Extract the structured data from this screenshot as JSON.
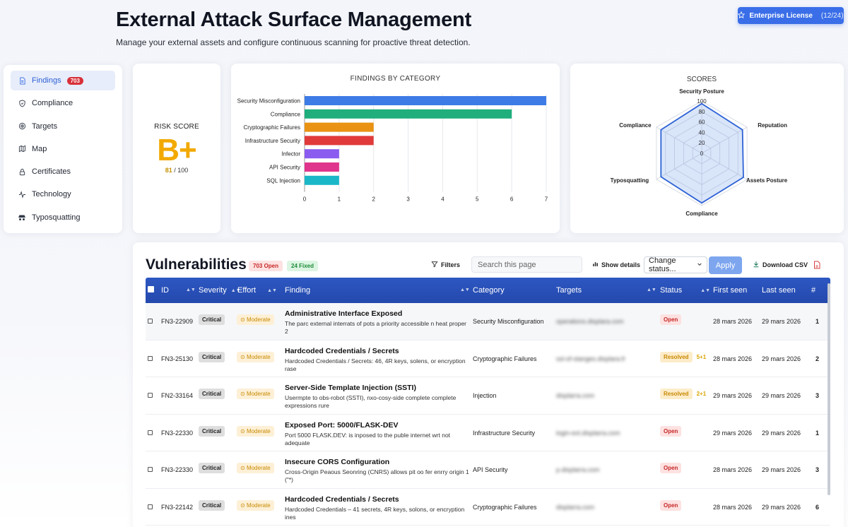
{
  "header": {
    "title": "External Attack Surface Management",
    "subtitle": "Manage your external assets and configure continuous scanning for proactive threat detection."
  },
  "license": {
    "label": "Enterprise License",
    "count": "(12/24)"
  },
  "sidebar": {
    "items": [
      {
        "label": "Findings",
        "badge": "703",
        "icon": "document-icon",
        "active": true
      },
      {
        "label": "Compliance",
        "icon": "shield-icon"
      },
      {
        "label": "Targets",
        "icon": "target-icon"
      },
      {
        "label": "Map",
        "icon": "map-icon"
      },
      {
        "label": "Certificates",
        "icon": "lock-icon"
      },
      {
        "label": "Technology",
        "icon": "pulse-icon"
      },
      {
        "label": "Typosquatting",
        "icon": "spy-icon"
      }
    ]
  },
  "risk": {
    "title": "RISK SCORE",
    "grade": "B+",
    "score": "81",
    "max": "/ 100"
  },
  "chart_data": [
    {
      "type": "bar",
      "orientation": "horizontal",
      "title": "FINDINGS BY CATEGORY",
      "categories": [
        "Security Misconfiguration",
        "Compliance",
        "Cryptographic Failures",
        "Infrastructure Security",
        "Infector",
        "API Security",
        "SQL Injection"
      ],
      "values": [
        7,
        6,
        2,
        2,
        1,
        1,
        1
      ],
      "colors": [
        "#3d7be6",
        "#1fae7c",
        "#e99213",
        "#e03a3a",
        "#8a5cf0",
        "#e0358c",
        "#1ab7c8"
      ],
      "xlim": [
        0,
        7
      ],
      "xticks": [
        "0",
        "1",
        "2",
        "3",
        "4",
        "5",
        "6",
        "7"
      ],
      "grid": true
    },
    {
      "type": "radar",
      "title": "SCORES",
      "axes": [
        "Security Posture",
        "Reputation",
        "Assets Posture",
        "Compliance",
        "Typosquatting",
        "Compliance"
      ],
      "values": [
        95,
        90,
        92,
        95,
        90,
        90
      ],
      "rlim": [
        0,
        100
      ],
      "rticks": [
        "0",
        "20",
        "40",
        "60",
        "80",
        "100"
      ],
      "color": "#2e62d6"
    }
  ],
  "vuln": {
    "title": "Vulnerabilities",
    "open_pill": "703 Open",
    "fixed_pill": "24 Fixed",
    "filters": "Filters",
    "search_placeholder": "Search this page",
    "show_details": "Show details",
    "change_status": "Change status...",
    "apply": "Apply",
    "download": "Download CSV",
    "columns": {
      "id": "ID",
      "severity": "Severity",
      "effort": "Effort",
      "finding": "Finding",
      "category": "Category",
      "targets": "Targets",
      "status": "Status",
      "first_seen": "First seen",
      "last_seen": "Last seen",
      "count": "#"
    },
    "rows": [
      {
        "id": "FN3-22909",
        "severity": "Critical",
        "effort": "Moderate",
        "title": "Administrative Interface Exposed",
        "desc": "The parc external interrats of pots a priority accessible n heat proper 2",
        "category": "Security Misconfiguration",
        "target": "operations.displara.com",
        "status": "Open",
        "delta": "",
        "first": "28 mars 2026",
        "last": "29 mars 2026",
        "count": "1"
      },
      {
        "id": "FN3-25130",
        "severity": "Critical",
        "effort": "Moderate",
        "title": "Hardcoded Credentials / Secrets",
        "desc": "Hardcoded Credentials / Secrets: 46, 4R keys, solens, or encryption rase",
        "category": "Cryptographic Failures",
        "target": "ssl-of-stanges.displara.fr",
        "status": "Resolved",
        "delta": "5+1",
        "first": "28 mars 2026",
        "last": "29 mars 2026",
        "count": "2"
      },
      {
        "id": "FN2-33164",
        "severity": "Critical",
        "effort": "Moderate",
        "title": "Server-Side Template Injection (SSTI)",
        "desc": "Usermpte to obs-robot (SSTI), nxo-cosy-side complete complete expressions rure",
        "category": "Injection",
        "target": "displarra.com",
        "status": "Resolved",
        "delta": "2+1",
        "first": "29 mars 2026",
        "last": "29 mars 2026",
        "count": "3"
      },
      {
        "id": "FN3-22330",
        "severity": "Critical",
        "effort": "Moderate",
        "title": "Exposed Port: 5000/FLASK-DEV",
        "desc": "Port 5000 FLASK.DEV: is inposed to the puble internet wrt not adequate",
        "category": "Infrastructure Security",
        "target": "login-ext.displarra.com",
        "status": "Open",
        "delta": "",
        "first": "29 mars 2026",
        "last": "29 mars 2026",
        "count": "1"
      },
      {
        "id": "FN3-22330",
        "severity": "Critical",
        "effort": "Moderate",
        "title": "Insecure CORS Configuration",
        "desc": "Cross-Origin Peaous Seonring (CNRS) allows pit oo fer enrry origin 1 (\"*)",
        "category": "API Security",
        "target": "p.displarra.com",
        "status": "Open",
        "delta": "",
        "first": "28 mars 2026",
        "last": "29 mars 2026",
        "count": "3"
      },
      {
        "id": "FN3-22142",
        "severity": "Critical",
        "effort": "Moderate",
        "title": "Hardcoded Credentials / Secrets",
        "desc": "Hardcoded Credentials – 41 secrets, 4R keys, solons, or encryption ines",
        "category": "Cryptographic Failures",
        "target": "displarra.com",
        "status": "Open",
        "delta": "",
        "first": "28 mars 2026",
        "last": "29 mars 2026",
        "count": "6"
      }
    ]
  }
}
